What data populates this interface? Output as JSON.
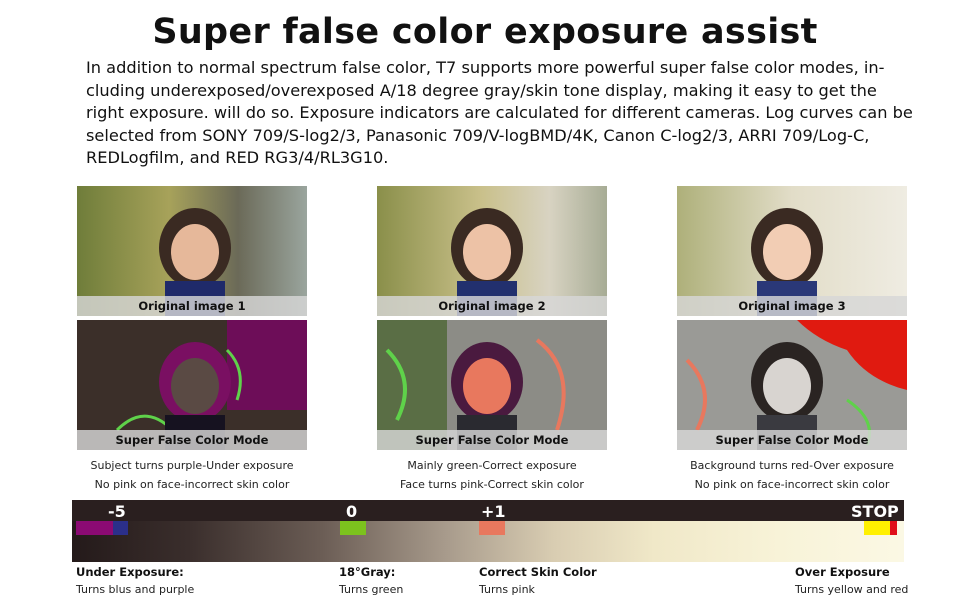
{
  "title": "Super false color exposure assist",
  "description_lines": [
    "In addition to normal spectrum false color, T7 supports more powerful super false color modes, in-",
    "cluding underexposed/overexposed A/18 degree gray/skin tone display, making it easy to get the",
    "right exposure. will do so. Exposure indicators are calculated for different cameras. Log curves can be",
    "selected from SONY 709/S-log2/3, Panasonic 709/V-logBMD/4K, Canon C-log2/3, ARRI 709/Log-C,",
    "REDLogfilm, and RED RG3/4/RL3G10."
  ],
  "examples": [
    {
      "original_caption": "Original image 1",
      "mode_caption": "Super False Color Mode",
      "note1": "Subject turns purple-Under exposure",
      "note2": "No pink on face-incorrect skin color"
    },
    {
      "original_caption": "Original image 2",
      "mode_caption": "Super False Color Mode",
      "note1": "Mainly green-Correct exposure",
      "note2": "Face turns pink-Correct skin color"
    },
    {
      "original_caption": "Original image 3",
      "mode_caption": "Super False Color Mode",
      "note1": "Background turns red-Over exposure",
      "note2": "No pink on face-incorrect skin color"
    }
  ],
  "scale": {
    "labels": [
      "-5",
      "0",
      "+1",
      "STOP"
    ],
    "colors": {
      "under_purple": "#8b0a73",
      "under_blue": "#2b2f8a",
      "gray_green": "#7cc21e",
      "skin_pink": "#e8785e",
      "over_yellow": "#fff000",
      "over_red": "#e0101a"
    }
  },
  "legend": [
    {
      "heading": "Under Exposure:",
      "sub": "Turns blus and purple"
    },
    {
      "heading": "18°Gray:",
      "sub": "Turns green"
    },
    {
      "heading": "Correct Skin Color",
      "sub": "Turns pink"
    },
    {
      "heading": "Over Exposure",
      "sub": "Turns yellow and red"
    }
  ]
}
